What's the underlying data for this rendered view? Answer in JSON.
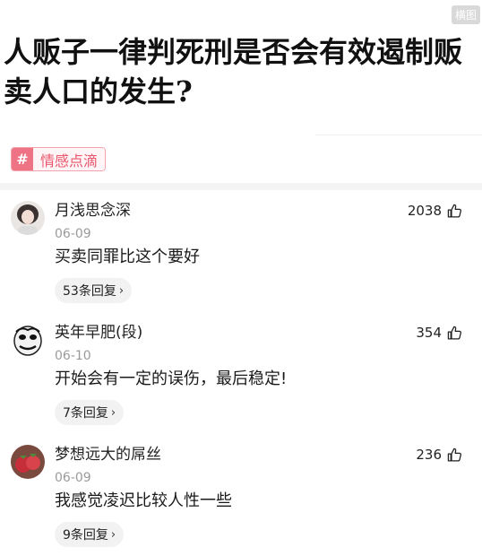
{
  "badge": {
    "label": "横图"
  },
  "question": {
    "title": "人贩子一律判死刑是否会有效遏制贩卖人口的发生?"
  },
  "topic": {
    "symbol": "#",
    "label": "情感点滴"
  },
  "comments": [
    {
      "username": "月浅思念深",
      "date": "06-09",
      "text": "买卖同罪比这个要好",
      "replies": "53条回复",
      "likes": "2038",
      "avatar": "woman-portrait-avatar"
    },
    {
      "username": "英年早肥(段)",
      "date": "06-10",
      "text": "开始会有一定的误伤，最后稳定!",
      "replies": "7条回复",
      "likes": "354",
      "avatar": "meme-face-avatar"
    },
    {
      "username": "梦想远大的屌丝",
      "date": "06-09",
      "text": "我感觉凌迟比较人性一些",
      "replies": "9条回复",
      "likes": "236",
      "avatar": "strawberry-avatar"
    }
  ],
  "icons": {
    "like": "thumb-up-icon",
    "chevron": "chevron-right-icon"
  },
  "colors": {
    "topic_accent": "#ee7384",
    "topic_text": "#e9576d",
    "meta_gray": "#9a9a9a"
  }
}
